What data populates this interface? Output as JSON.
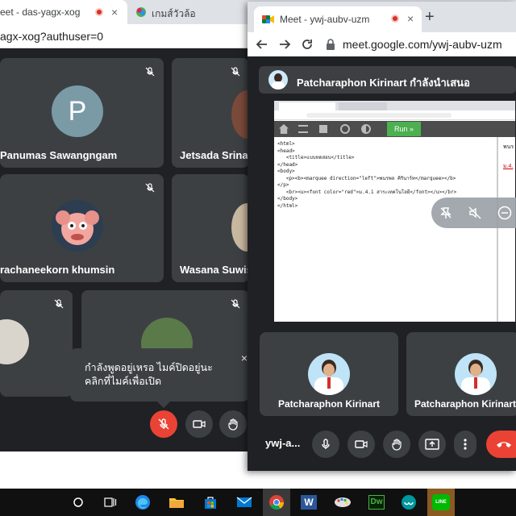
{
  "bg_window": {
    "tabs": [
      {
        "title": "eet - das-yagx-xog"
      },
      {
        "title": "เกมส์วัวล้อ"
      }
    ],
    "url": "agx-xog?authuser=0",
    "participants": [
      {
        "name": "Panumas Sawangngam",
        "initial": "P"
      },
      {
        "name": "Jetsada Srinak"
      },
      {
        "name": "rachaneekorn khumsin"
      },
      {
        "name": "Wasana Suwise"
      }
    ],
    "tooltip": "กำลังพูดอยู่เหรอ ไมค์ปิดอยู่นะ คลิกที่ไมค์เพื่อเปิด",
    "tooltip_close": "×"
  },
  "popup": {
    "tab_title": "Meet - ywj-aubv-uzm",
    "tab_close": "×",
    "new_tab": "+",
    "url": "meet.google.com/ywj-aubv-uzm",
    "presenter_text": "Patcharaphon Kirinart กำลังนำเสนอ",
    "shared_screen": {
      "run_label": "Run »",
      "code_lines": [
        "<html>",
        "<head>",
        "   <title>แบบทดสอบ</title>",
        "</head>",
        "<body>",
        "   <p><b><marquee direction=\"left\">พนรพล คิรินาร์ท</marquee></b>",
        "</p>",
        "   <br><u><font color=\"red\">ม.4.1 สาระเทคโนโลยี</font></u></br>",
        "</body>",
        "</html>"
      ],
      "right_text_1": "พนร",
      "right_text_2": "ม.4."
    },
    "tiles": [
      {
        "name": "Patcharaphon Kirinart"
      },
      {
        "name": "Patcharaphon Kirinart"
      }
    ],
    "meeting_code": "ywj-a...",
    "colors": {
      "end_call": "#ea4335",
      "tile": "#3c4043",
      "bg": "#202124"
    }
  },
  "taskbar": {
    "items": [
      "search-icon",
      "task-view-icon",
      "edge-icon",
      "file-explorer-icon",
      "store-icon",
      "mail-icon",
      "chrome-icon",
      "word-icon",
      "paint-icon",
      "dreamweaver-icon",
      "arduino-icon",
      "line-icon"
    ],
    "dw_label": "Dw",
    "word_label": "W",
    "line_label": "LINE"
  }
}
